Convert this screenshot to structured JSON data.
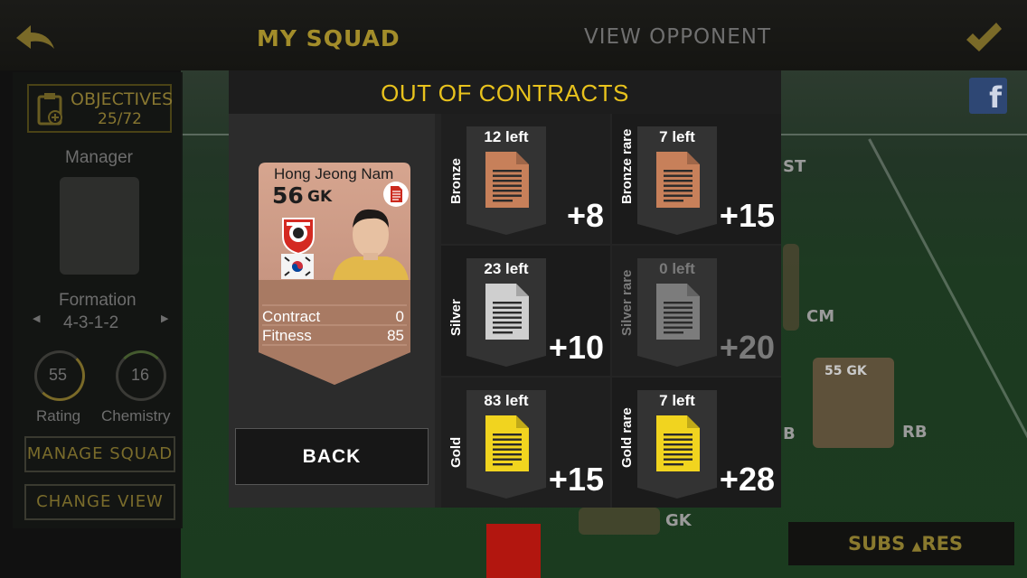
{
  "topbar": {
    "tab_my_squad": "MY SQUAD",
    "tab_view_opponent": "VIEW OPPONENT"
  },
  "sidebar": {
    "objectives_label": "OBJECTIVES",
    "objectives_count": "25/72",
    "manager_label": "Manager",
    "formation_label": "Formation",
    "formation_value": "4-3-1-2",
    "rating_value": "55",
    "rating_label": "Rating",
    "chemistry_value": "16",
    "chemistry_label": "Chemistry",
    "manage_squad_button": "MANAGE SQUAD",
    "change_view_button": "CHANGE VIEW"
  },
  "background_pitch": {
    "positions": [
      "ST",
      "CM",
      "B",
      "RB",
      "GK"
    ],
    "card_rating_pos": "55 GK",
    "subs_label": "SUBS",
    "res_label": "RES"
  },
  "modal": {
    "title": "OUT OF CONTRACTS",
    "back_button": "BACK",
    "player": {
      "name": "Hong Jeong Nam",
      "rating": "56",
      "position": "GK",
      "contract_label": "Contract",
      "contract_value": "0",
      "fitness_label": "Fitness",
      "fitness_value": "85"
    },
    "contracts": [
      {
        "label": "Bronze",
        "left": "12 left",
        "bonus": "+8",
        "color": "#c7805a",
        "available": true
      },
      {
        "label": "Bronze rare",
        "left": "7 left",
        "bonus": "+15",
        "color": "#c7805a",
        "available": true
      },
      {
        "label": "Silver",
        "left": "23 left",
        "bonus": "+10",
        "color": "#cfcfcf",
        "available": true
      },
      {
        "label": "Silver rare",
        "left": "0 left",
        "bonus": "+20",
        "color": "#7c7c7c",
        "available": false
      },
      {
        "label": "Gold",
        "left": "83 left",
        "bonus": "+15",
        "color": "#f1d41f",
        "available": true
      },
      {
        "label": "Gold rare",
        "left": "7 left",
        "bonus": "+28",
        "color": "#f1d41f",
        "available": true
      }
    ]
  },
  "colors": {
    "accent_gold": "#e8c21d",
    "bronze": "#c7805a",
    "silver": "#cfcfcf",
    "gold": "#f1d41f"
  }
}
